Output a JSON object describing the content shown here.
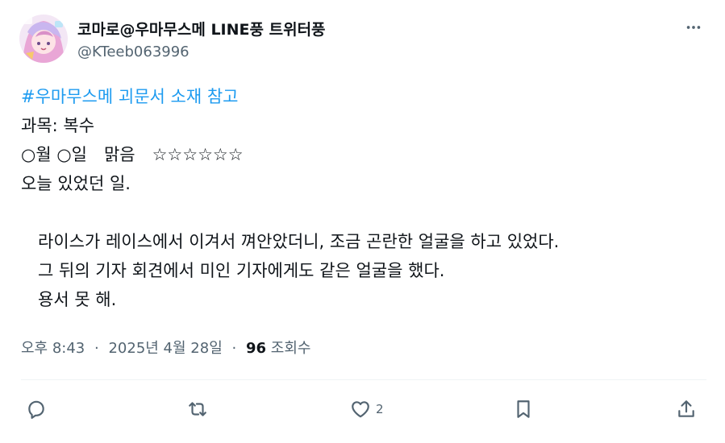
{
  "author": {
    "display_name": "코마로@우마무스메 LINE풍 트위터풍",
    "handle": "@KTeeb063996",
    "avatar_icon": "avatar-anime-character"
  },
  "more_icon": "more-horizontal-icon",
  "post": {
    "lines": [
      {
        "kind": "hashtag",
        "text": "#우마무스메 괴문서 소재 참고"
      },
      {
        "kind": "text",
        "text": "과목: 복수"
      },
      {
        "kind": "text",
        "text": "○월 ○일　맑음　☆☆☆☆☆☆"
      },
      {
        "kind": "text",
        "text": "오늘 있었던 일."
      },
      {
        "kind": "text",
        "text": ""
      },
      {
        "kind": "text",
        "text": "　라이스가 레이스에서 이겨서 껴안았더니, 조금 곤란한 얼굴을 하고 있었다."
      },
      {
        "kind": "text",
        "text": "　그 뒤의 기자 회견에서 미인 기자에게도 같은 얼굴을 했다."
      },
      {
        "kind": "text",
        "text": "　용서 못 해."
      }
    ]
  },
  "meta": {
    "time": "오후 8:43",
    "separator": "·",
    "date": "2025년 4월 28일",
    "views_count": "96",
    "views_label": "조회수"
  },
  "actions": {
    "reply_icon": "reply-icon",
    "retweet_icon": "retweet-icon",
    "like_icon": "heart-icon",
    "like_count": "2",
    "bookmark_icon": "bookmark-icon",
    "share_icon": "share-icon"
  },
  "colors": {
    "hashtag": "#1d9bf0",
    "text": "#0f1419",
    "secondary": "#536471",
    "divider": "#eff3f4"
  }
}
